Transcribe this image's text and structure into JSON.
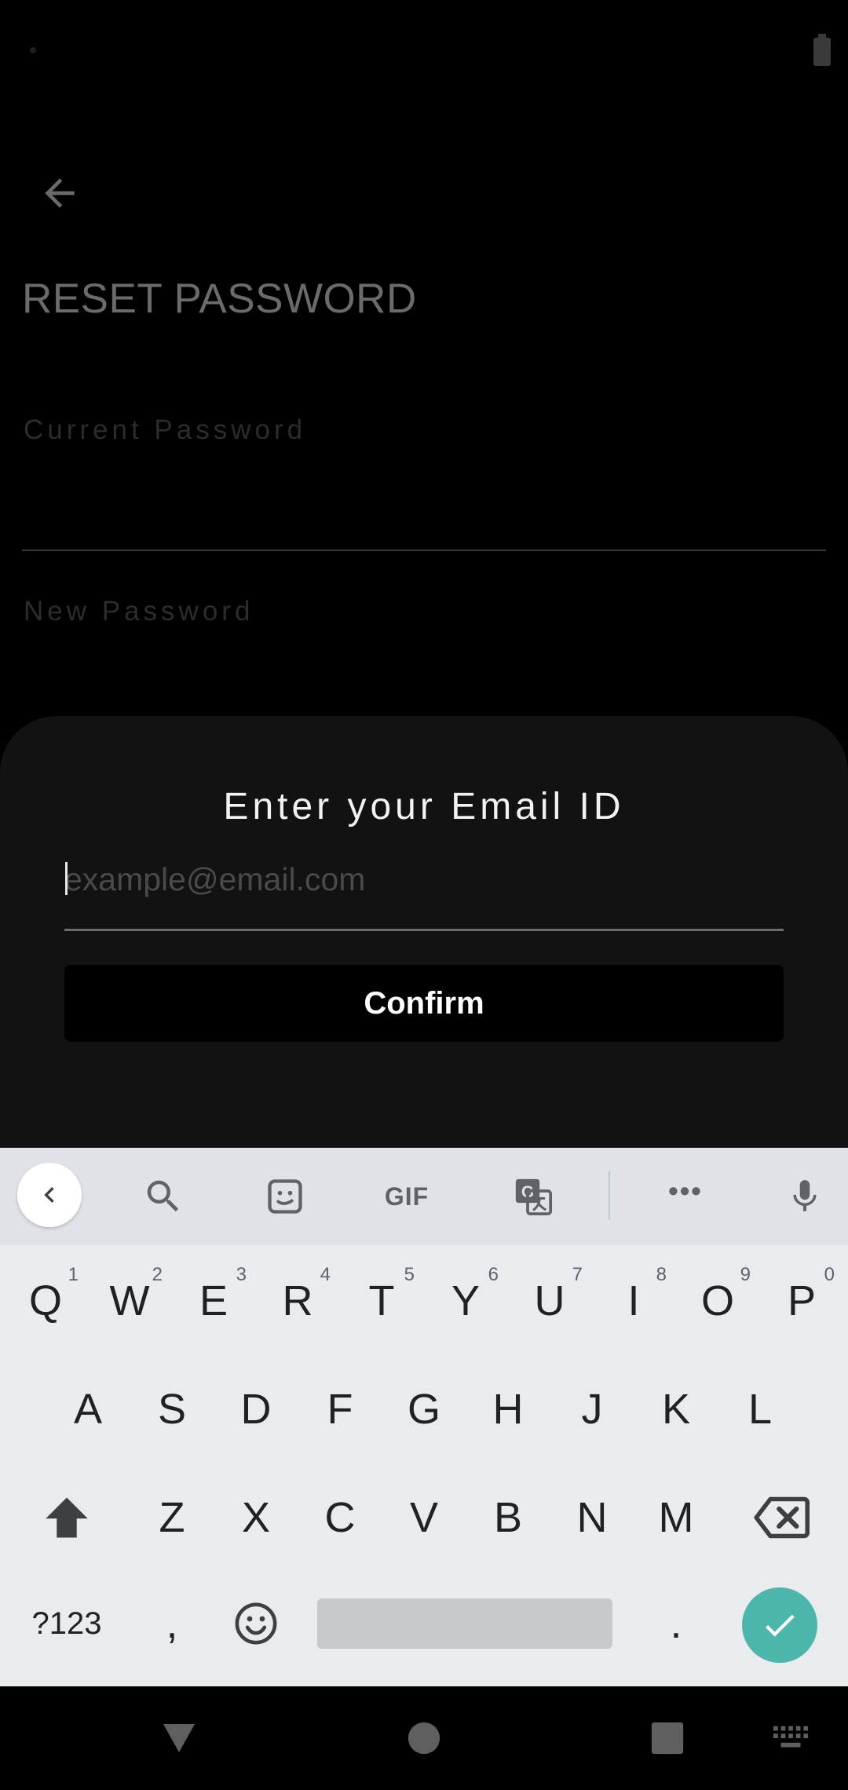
{
  "screen": {
    "title": "RESET PASSWORD",
    "fields": [
      {
        "label": "Current Password"
      },
      {
        "label": "New Password"
      }
    ]
  },
  "sheet": {
    "title": "Enter your Email ID",
    "email_placeholder": "example@email.com",
    "email_value": "",
    "confirm_label": "Confirm"
  },
  "keyboard": {
    "toolbar": {
      "gif_label": "GIF",
      "more_label": "•••"
    },
    "row1": [
      {
        "label": "Q",
        "hint": "1"
      },
      {
        "label": "W",
        "hint": "2"
      },
      {
        "label": "E",
        "hint": "3"
      },
      {
        "label": "R",
        "hint": "4"
      },
      {
        "label": "T",
        "hint": "5"
      },
      {
        "label": "Y",
        "hint": "6"
      },
      {
        "label": "U",
        "hint": "7"
      },
      {
        "label": "I",
        "hint": "8"
      },
      {
        "label": "O",
        "hint": "9"
      },
      {
        "label": "P",
        "hint": "0"
      }
    ],
    "row2": [
      "A",
      "S",
      "D",
      "F",
      "G",
      "H",
      "J",
      "K",
      "L"
    ],
    "row3": [
      "Z",
      "X",
      "C",
      "V",
      "B",
      "N",
      "M"
    ],
    "row4": {
      "symbols_label": "?123",
      "comma_label": ",",
      "period_label": "."
    },
    "enter_color": "#4db6ac"
  },
  "colors": {
    "background": "#000000",
    "sheet": "#121212",
    "keyboard": "#e9ecef"
  }
}
